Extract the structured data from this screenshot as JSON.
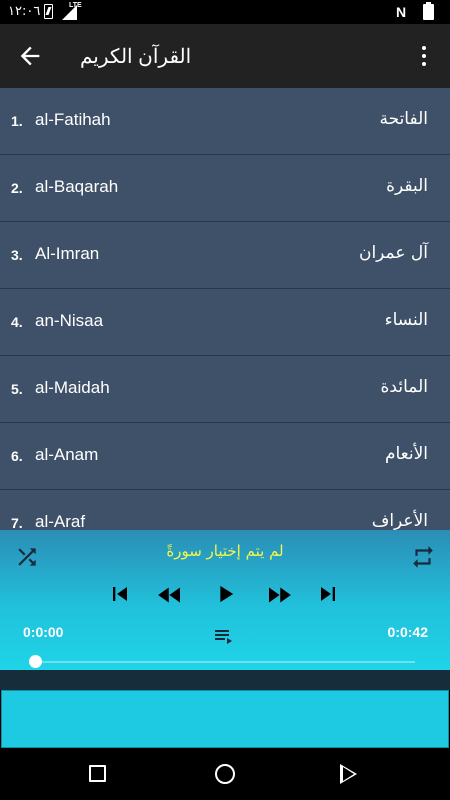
{
  "status_bar": {
    "time": "١٢:٠٦",
    "network": "LTE"
  },
  "app_bar": {
    "title": "القرآن الكريم"
  },
  "surahs": [
    {
      "number": "1.",
      "english": "al-Fatihah",
      "arabic": "الفاتحة"
    },
    {
      "number": "2.",
      "english": "al-Baqarah",
      "arabic": "البقرة"
    },
    {
      "number": "3.",
      "english": "Al-Imran",
      "arabic": "آل عمران"
    },
    {
      "number": "4.",
      "english": "an-Nisaa",
      "arabic": "النساء"
    },
    {
      "number": "5.",
      "english": "al-Maidah",
      "arabic": "المائدة"
    },
    {
      "number": "6.",
      "english": "al-Anam",
      "arabic": "الأنعام"
    },
    {
      "number": "7.",
      "english": "al-Araf",
      "arabic": "الأعراف"
    }
  ],
  "player": {
    "status": "لم يتم إختيار سورةً",
    "current_time": "0:0:00",
    "total_time": "0:0:42",
    "progress": 0
  }
}
